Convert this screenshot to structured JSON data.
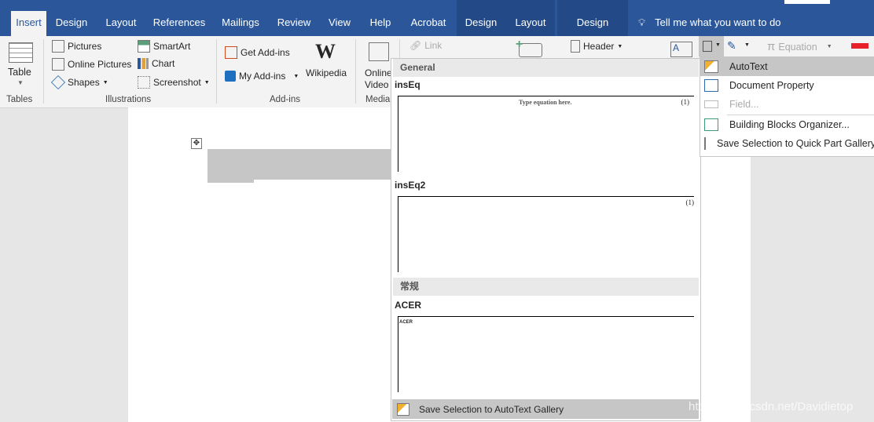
{
  "tabs": {
    "insert": "Insert",
    "design": "Design",
    "layout": "Layout",
    "references": "References",
    "mailings": "Mailings",
    "review": "Review",
    "view": "View",
    "help": "Help",
    "acrobat": "Acrobat",
    "table_design": "Design",
    "table_layout": "Layout",
    "header_design": "Design",
    "tell_me": "Tell me what you want to do"
  },
  "ribbon": {
    "table": "Table",
    "tables_group": "Tables",
    "pictures": "Pictures",
    "online_pictures": "Online Pictures",
    "shapes": "Shapes",
    "smartart": "SmartArt",
    "chart": "Chart",
    "screenshot": "Screenshot",
    "illustrations_group": "Illustrations",
    "get_addins": "Get Add-ins",
    "my_addins": "My Add-ins",
    "wikipedia": "Wikipedia",
    "addins_group": "Add-ins",
    "online_video_1": "Online",
    "online_video_2": "Video",
    "media_group": "Media",
    "link": "Link",
    "header": "Header",
    "equation": "Equation"
  },
  "gallery": {
    "section1": "General",
    "entry1": "insEq",
    "entry1_preview": "Type equation here.",
    "entry1_num": "(1)",
    "entry2": "insEq2",
    "entry2_num": "(1)",
    "section2": "常规",
    "entry3": "ACER",
    "entry3_preview": "ACER",
    "save_label": "Save Selection to AutoText Gallery"
  },
  "menu": {
    "autotext": "AutoText",
    "document_property": "Document Property",
    "field": "Field...",
    "organizer": "Building Blocks Organizer...",
    "save_quick": "Save Selection to Quick Part Gallery..."
  },
  "watermark": "https://blog.csdn.net/Davidietop"
}
